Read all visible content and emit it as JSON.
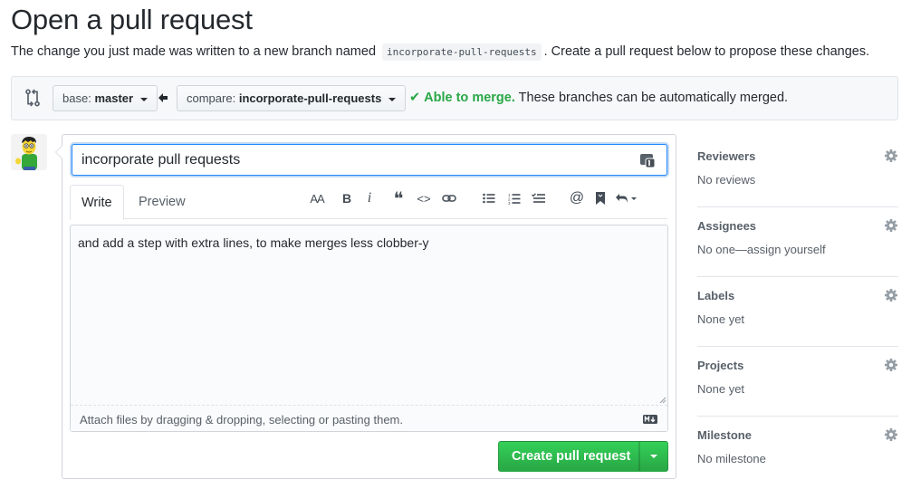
{
  "page": {
    "title": "Open a pull request",
    "subtitle_before": "The change you just made was written to a new branch named",
    "branch_name": "incorporate-pull-requests",
    "subtitle_after": ". Create a pull request below to propose these changes."
  },
  "range": {
    "base_label": "base:",
    "base_value": "master",
    "compare_label": "compare:",
    "compare_value": "incorporate-pull-requests",
    "merge_check": "✔",
    "merge_ok": "Able to merge.",
    "merge_detail": "These branches can be automatically merged."
  },
  "composer": {
    "title_value": "incorporate pull requests",
    "tabs": [
      {
        "label": "Write",
        "active": true
      },
      {
        "label": "Preview",
        "active": false
      }
    ],
    "toolbar": {
      "heading": "AA",
      "bold": "B",
      "italic": "i",
      "quote": "❝",
      "code": "<>",
      "link": "⊘",
      "bullets": "☰",
      "numbered": "☷",
      "tasks": "☑",
      "mention": "@",
      "reference": "🔖",
      "reply": "↩"
    },
    "body_value": "and add a step with extra lines, to make merges less clobber-y",
    "attach_hint": "Attach files by dragging & dropping, selecting or pasting them.",
    "submit_label": "Create pull request"
  },
  "sidebar": [
    {
      "heading": "Reviewers",
      "value": "No reviews"
    },
    {
      "heading": "Assignees",
      "value": "No one—assign yourself"
    },
    {
      "heading": "Labels",
      "value": "None yet"
    },
    {
      "heading": "Projects",
      "value": "None yet"
    },
    {
      "heading": "Milestone",
      "value": "No milestone"
    }
  ],
  "colors": {
    "accent_green": "#28a745",
    "focus_blue": "#2188ff",
    "muted_text": "#586069"
  }
}
